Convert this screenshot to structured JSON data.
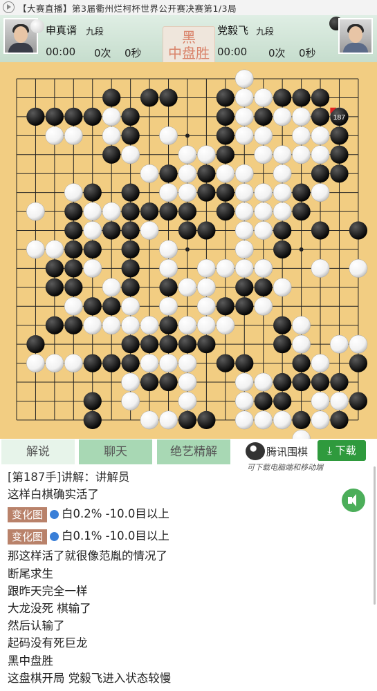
{
  "header": {
    "marquee": "【大赛直播】第3届衢州烂柯杯世界公开赛决赛第1/3局"
  },
  "players": {
    "black": {
      "name": "申真谞",
      "rank": "九段",
      "time": "00:00",
      "count": "0次",
      "seconds": "0秒"
    },
    "white": {
      "name": "党毅飞",
      "rank": "九段",
      "time": "00:00",
      "count": "0次",
      "seconds": "0秒"
    },
    "result_line1": "黑",
    "result_line2": "中盘胜"
  },
  "board": {
    "size": 19,
    "last_move_label": "187",
    "last_move": [
      17,
      2
    ],
    "black": [
      [
        5,
        1
      ],
      [
        7,
        1
      ],
      [
        8,
        1
      ],
      [
        11,
        1
      ],
      [
        14,
        1
      ],
      [
        15,
        1
      ],
      [
        16,
        1
      ],
      [
        1,
        2
      ],
      [
        2,
        2
      ],
      [
        3,
        2
      ],
      [
        4,
        2
      ],
      [
        6,
        2
      ],
      [
        11,
        2
      ],
      [
        13,
        2
      ],
      [
        16,
        2
      ],
      [
        6,
        3
      ],
      [
        11,
        3
      ],
      [
        17,
        3
      ],
      [
        5,
        4
      ],
      [
        11,
        4
      ],
      [
        17,
        4
      ],
      [
        8,
        5
      ],
      [
        10,
        5
      ],
      [
        16,
        5
      ],
      [
        17,
        5
      ],
      [
        4,
        6
      ],
      [
        6,
        6
      ],
      [
        10,
        6
      ],
      [
        11,
        6
      ],
      [
        15,
        6
      ],
      [
        3,
        7
      ],
      [
        6,
        7
      ],
      [
        7,
        7
      ],
      [
        8,
        7
      ],
      [
        9,
        7
      ],
      [
        11,
        7
      ],
      [
        15,
        7
      ],
      [
        3,
        8
      ],
      [
        5,
        8
      ],
      [
        6,
        8
      ],
      [
        9,
        8
      ],
      [
        10,
        8
      ],
      [
        14,
        8
      ],
      [
        16,
        8
      ],
      [
        18,
        8
      ],
      [
        3,
        9
      ],
      [
        4,
        9
      ],
      [
        6,
        9
      ],
      [
        14,
        9
      ],
      [
        2,
        10
      ],
      [
        3,
        10
      ],
      [
        6,
        10
      ],
      [
        13,
        10
      ],
      [
        2,
        11
      ],
      [
        3,
        11
      ],
      [
        6,
        11
      ],
      [
        8,
        11
      ],
      [
        12,
        11
      ],
      [
        13,
        11
      ],
      [
        4,
        12
      ],
      [
        5,
        12
      ],
      [
        11,
        12
      ],
      [
        12,
        12
      ],
      [
        2,
        13
      ],
      [
        3,
        13
      ],
      [
        8,
        13
      ],
      [
        14,
        13
      ],
      [
        1,
        14
      ],
      [
        6,
        14
      ],
      [
        7,
        14
      ],
      [
        8,
        14
      ],
      [
        9,
        14
      ],
      [
        10,
        14
      ],
      [
        14,
        14
      ],
      [
        4,
        15
      ],
      [
        5,
        15
      ],
      [
        6,
        15
      ],
      [
        11,
        15
      ],
      [
        12,
        15
      ],
      [
        15,
        15
      ],
      [
        18,
        15
      ],
      [
        7,
        16
      ],
      [
        8,
        16
      ],
      [
        14,
        16
      ],
      [
        15,
        16
      ],
      [
        16,
        16
      ],
      [
        17,
        16
      ],
      [
        4,
        17
      ],
      [
        12,
        17
      ],
      [
        13,
        17
      ],
      [
        14,
        17
      ],
      [
        18,
        17
      ],
      [
        4,
        18
      ],
      [
        9,
        18
      ],
      [
        10,
        18
      ],
      [
        15,
        18
      ],
      [
        17,
        18
      ]
    ],
    "white": [
      [
        12,
        0
      ],
      [
        12,
        1
      ],
      [
        13,
        1
      ],
      [
        5,
        2
      ],
      [
        12,
        2
      ],
      [
        14,
        2
      ],
      [
        15,
        2
      ],
      [
        17,
        2
      ],
      [
        2,
        3
      ],
      [
        3,
        3
      ],
      [
        5,
        3
      ],
      [
        8,
        3
      ],
      [
        12,
        3
      ],
      [
        13,
        3
      ],
      [
        15,
        3
      ],
      [
        16,
        3
      ],
      [
        6,
        4
      ],
      [
        9,
        4
      ],
      [
        10,
        4
      ],
      [
        13,
        4
      ],
      [
        14,
        4
      ],
      [
        15,
        4
      ],
      [
        16,
        4
      ],
      [
        7,
        5
      ],
      [
        9,
        5
      ],
      [
        11,
        5
      ],
      [
        12,
        5
      ],
      [
        14,
        5
      ],
      [
        3,
        6
      ],
      [
        8,
        6
      ],
      [
        9,
        6
      ],
      [
        12,
        6
      ],
      [
        13,
        6
      ],
      [
        14,
        6
      ],
      [
        16,
        6
      ],
      [
        1,
        7
      ],
      [
        4,
        7
      ],
      [
        5,
        7
      ],
      [
        12,
        7
      ],
      [
        13,
        7
      ],
      [
        14,
        7
      ],
      [
        4,
        8
      ],
      [
        7,
        8
      ],
      [
        12,
        8
      ],
      [
        13,
        8
      ],
      [
        1,
        9
      ],
      [
        2,
        9
      ],
      [
        8,
        9
      ],
      [
        12,
        9
      ],
      [
        4,
        10
      ],
      [
        8,
        10
      ],
      [
        10,
        10
      ],
      [
        11,
        10
      ],
      [
        12,
        10
      ],
      [
        13,
        10
      ],
      [
        16,
        10
      ],
      [
        18,
        10
      ],
      [
        5,
        11
      ],
      [
        9,
        11
      ],
      [
        10,
        11
      ],
      [
        14,
        11
      ],
      [
        3,
        12
      ],
      [
        6,
        12
      ],
      [
        8,
        12
      ],
      [
        10,
        12
      ],
      [
        13,
        12
      ],
      [
        4,
        13
      ],
      [
        5,
        13
      ],
      [
        6,
        13
      ],
      [
        7,
        13
      ],
      [
        9,
        13
      ],
      [
        10,
        13
      ],
      [
        11,
        13
      ],
      [
        15,
        13
      ],
      [
        15,
        14
      ],
      [
        17,
        14
      ],
      [
        18,
        14
      ],
      [
        1,
        15
      ],
      [
        2,
        15
      ],
      [
        3,
        15
      ],
      [
        7,
        15
      ],
      [
        8,
        15
      ],
      [
        9,
        15
      ],
      [
        16,
        15
      ],
      [
        6,
        16
      ],
      [
        9,
        16
      ],
      [
        12,
        16
      ],
      [
        13,
        16
      ],
      [
        6,
        17
      ],
      [
        9,
        17
      ],
      [
        12,
        17
      ],
      [
        16,
        17
      ],
      [
        17,
        17
      ],
      [
        7,
        18
      ],
      [
        8,
        18
      ],
      [
        12,
        18
      ],
      [
        13,
        18
      ],
      [
        14,
        18
      ],
      [
        16,
        18
      ],
      [
        15,
        19
      ]
    ]
  },
  "tabs": [
    "解说",
    "聊天",
    "绝艺精解"
  ],
  "promo": {
    "name": "腾讯围棋",
    "download": "下载",
    "note": "可下载电脑端和移动端"
  },
  "comments": {
    "header": "[第187手]讲解：讲解员",
    "line1": "这样白棋确实活了",
    "var1_btn": "变化图",
    "var1_text": "白0.2% -10.0目以上",
    "var2_btn": "变化图",
    "var2_text": "白0.1% -10.0目以上",
    "lines": [
      "那这样活了就很像范胤的情况了",
      "断尾求生",
      "跟昨天完全一样",
      "大龙没死 棋输了",
      "然后认输了",
      "起码没有死巨龙",
      "黑中盘胜",
      "这盘棋开局 党毅飞进入状态较慢"
    ]
  }
}
